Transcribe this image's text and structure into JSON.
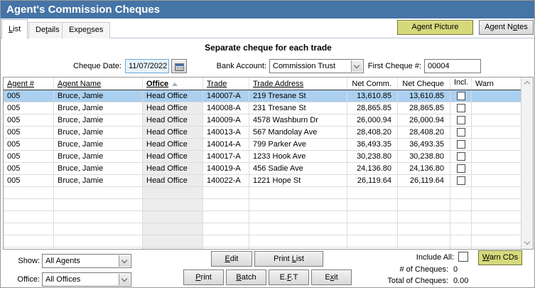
{
  "colors": {
    "title_bar": "#4574a6",
    "selection": "#abd0f0",
    "accent_button": "#d6d97b",
    "date_field_bg": "#e7f3fb"
  },
  "window": {
    "title": "Agent's Commission Cheques"
  },
  "tabs": {
    "list": {
      "pre": "",
      "key": "L",
      "post": "ist"
    },
    "details": {
      "pre": "De",
      "key": "t",
      "post": "ails"
    },
    "expenses": {
      "pre": "Expe",
      "key": "n",
      "post": "ses"
    }
  },
  "top_buttons": {
    "agent_picture": {
      "pre": "A",
      "key": "g",
      "post": "ent Picture"
    },
    "agent_notes": {
      "pre": "Agent N",
      "key": "o",
      "post": "tes"
    }
  },
  "form": {
    "subtitle": "Separate cheque for each trade",
    "cheque_date_label": "Cheque Date:",
    "cheque_date_value": "11/07/2022",
    "bank_account_label": "Bank Account:",
    "bank_account_value": "Commission Trust",
    "first_cheque_label": "First Cheque #:",
    "first_cheque_value": "00004"
  },
  "table": {
    "headers": [
      {
        "key": "agent",
        "label": "Agent #",
        "underline": true
      },
      {
        "key": "name",
        "label": "Agent Name",
        "underline": true
      },
      {
        "key": "office",
        "label": "Office",
        "underline": true,
        "sorted": "asc"
      },
      {
        "key": "trade",
        "label": "Trade",
        "underline": true
      },
      {
        "key": "address",
        "label": "Trade Address",
        "underline": true
      },
      {
        "key": "net_comm",
        "label": "Net Comm.",
        "underline": false,
        "align": "right"
      },
      {
        "key": "net_cheque",
        "label": "Net Cheque",
        "underline": false,
        "align": "right"
      },
      {
        "key": "incl",
        "label": "Incl.",
        "underline": false
      },
      {
        "key": "warn",
        "label": "Warn",
        "underline": false
      }
    ],
    "rows": [
      {
        "agent": "005",
        "name": "Bruce, Jamie",
        "office": "Head Office",
        "trade": "140007-A",
        "address": "219 Tresane St",
        "net_comm": "13,610.85",
        "net_cheque": "13,610.85",
        "incl_checked": false,
        "selected": true
      },
      {
        "agent": "005",
        "name": "Bruce, Jamie",
        "office": "Head Office",
        "trade": "140008-A",
        "address": "231 Tresane St",
        "net_comm": "28,865.85",
        "net_cheque": "28,865.85",
        "incl_checked": false,
        "selected": false
      },
      {
        "agent": "005",
        "name": "Bruce, Jamie",
        "office": "Head Office",
        "trade": "140009-A",
        "address": "4578 Washburn Dr",
        "net_comm": "26,000.94",
        "net_cheque": "26,000.94",
        "incl_checked": false,
        "selected": false
      },
      {
        "agent": "005",
        "name": "Bruce, Jamie",
        "office": "Head Office",
        "trade": "140013-A",
        "address": "567 Mandolay Ave",
        "net_comm": "28,408.20",
        "net_cheque": "28,408.20",
        "incl_checked": false,
        "selected": false
      },
      {
        "agent": "005",
        "name": "Bruce, Jamie",
        "office": "Head Office",
        "trade": "140014-A",
        "address": "799 Parker Ave",
        "net_comm": "36,493.35",
        "net_cheque": "36,493.35",
        "incl_checked": false,
        "selected": false
      },
      {
        "agent": "005",
        "name": "Bruce, Jamie",
        "office": "Head Office",
        "trade": "140017-A",
        "address": "1233 Hook Ave",
        "net_comm": "30,238.80",
        "net_cheque": "30,238.80",
        "incl_checked": false,
        "selected": false
      },
      {
        "agent": "005",
        "name": "Bruce, Jamie",
        "office": "Head Office",
        "trade": "140019-A",
        "address": "456 Sadie Ave",
        "net_comm": "24,136.80",
        "net_cheque": "24,136.80",
        "incl_checked": false,
        "selected": false
      },
      {
        "agent": "005",
        "name": "Bruce, Jamie",
        "office": "Head Office",
        "trade": "140022-A",
        "address": "1221 Hope St",
        "net_comm": "26,119.64",
        "net_cheque": "26,119.64",
        "incl_checked": false,
        "selected": false
      }
    ],
    "filler_rows": 6
  },
  "footer": {
    "show_label": "Show:",
    "show_value": "All Agents",
    "office_label": "Office:",
    "office_value": "All Offices",
    "buttons": {
      "edit": {
        "pre": "",
        "key": "E",
        "post": "dit"
      },
      "print_list": {
        "pre": "Print ",
        "key": "L",
        "post": "ist"
      },
      "print": {
        "pre": "",
        "key": "P",
        "post": "rint"
      },
      "batch": {
        "pre": "",
        "key": "B",
        "post": "atch"
      },
      "eft": {
        "pre": "E.",
        "key": "F",
        "post": ".T"
      },
      "exit": {
        "pre": "E",
        "key": "x",
        "post": "it"
      },
      "warn_cds": {
        "pre": "",
        "key": "W",
        "post": "arn CDs"
      }
    },
    "include_all_label": "Include All:",
    "num_cheques_label": "# of Cheques:",
    "num_cheques_value": "0",
    "total_cheques_label": "Total of Cheques:",
    "total_cheques_value": "0.00"
  }
}
